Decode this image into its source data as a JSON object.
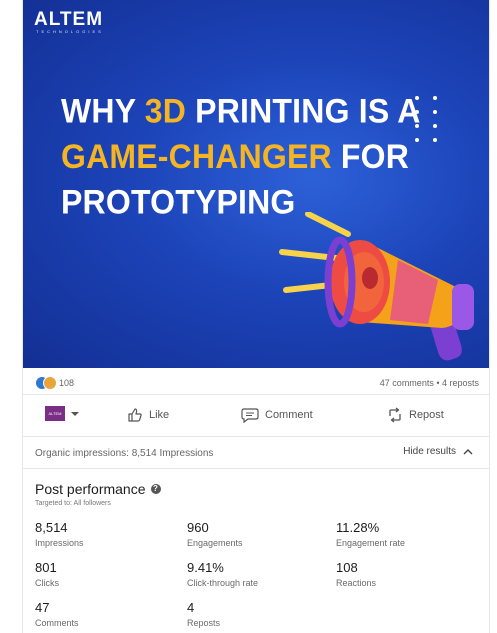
{
  "post": {
    "brand": "ALTEM",
    "brand_sub": "TECHNOLOGIES",
    "headline": {
      "l1_a": "WHY ",
      "l1_hl": "3D",
      "l1_b": " PRINTING IS A",
      "l2_hl": "GAME-CHANGER",
      "l2_b": " FOR",
      "l3": "PROTOTYPING"
    },
    "colors": {
      "hero_blue": "#1c43b8",
      "accent": "#f5b522"
    }
  },
  "social": {
    "reactions_count": "108",
    "comments_reposts": "47 comments • 4 reposts"
  },
  "actions": {
    "avatar_text": "ALTEM",
    "like": "Like",
    "comment": "Comment",
    "repost": "Repost"
  },
  "organic": {
    "text": "Organic impressions: 8,514 Impressions",
    "hide_results": "Hide results"
  },
  "performance": {
    "title": "Post performance",
    "targeted": "Targeted to: All followers",
    "metrics": [
      {
        "value": "8,514",
        "label": "Impressions"
      },
      {
        "value": "960",
        "label": "Engagements"
      },
      {
        "value": "11.28%",
        "label": "Engagement rate"
      },
      {
        "value": "801",
        "label": "Clicks"
      },
      {
        "value": "9.41%",
        "label": "Click-through rate"
      },
      {
        "value": "108",
        "label": "Reactions"
      },
      {
        "value": "47",
        "label": "Comments"
      },
      {
        "value": "4",
        "label": "Reposts"
      }
    ]
  }
}
